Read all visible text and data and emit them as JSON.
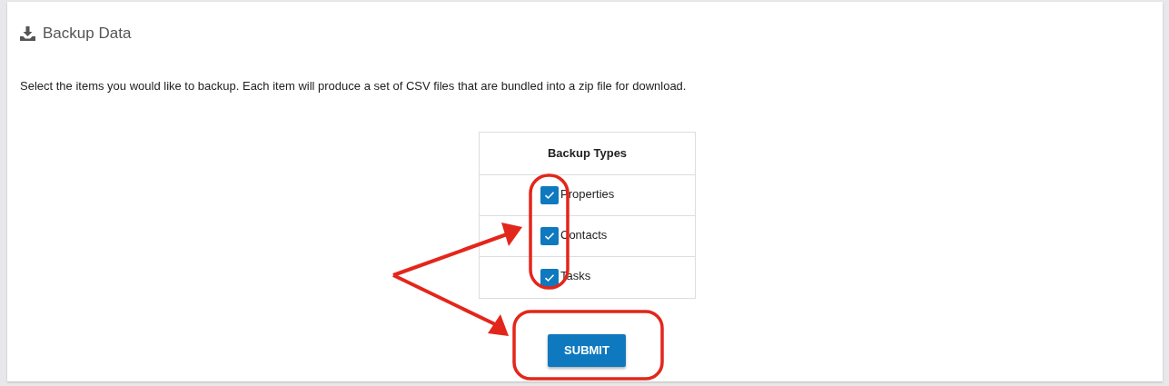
{
  "panel": {
    "title": "Backup Data",
    "description": "Select the items you would like to backup. Each item will produce a set of CSV files that are bundled into a zip file for download."
  },
  "table": {
    "heading": "Backup Types",
    "rows": [
      {
        "label": "Properties",
        "checked": true
      },
      {
        "label": "Contacts",
        "checked": true
      },
      {
        "label": "Tasks",
        "checked": true
      }
    ]
  },
  "submit_button": "SUBMIT"
}
